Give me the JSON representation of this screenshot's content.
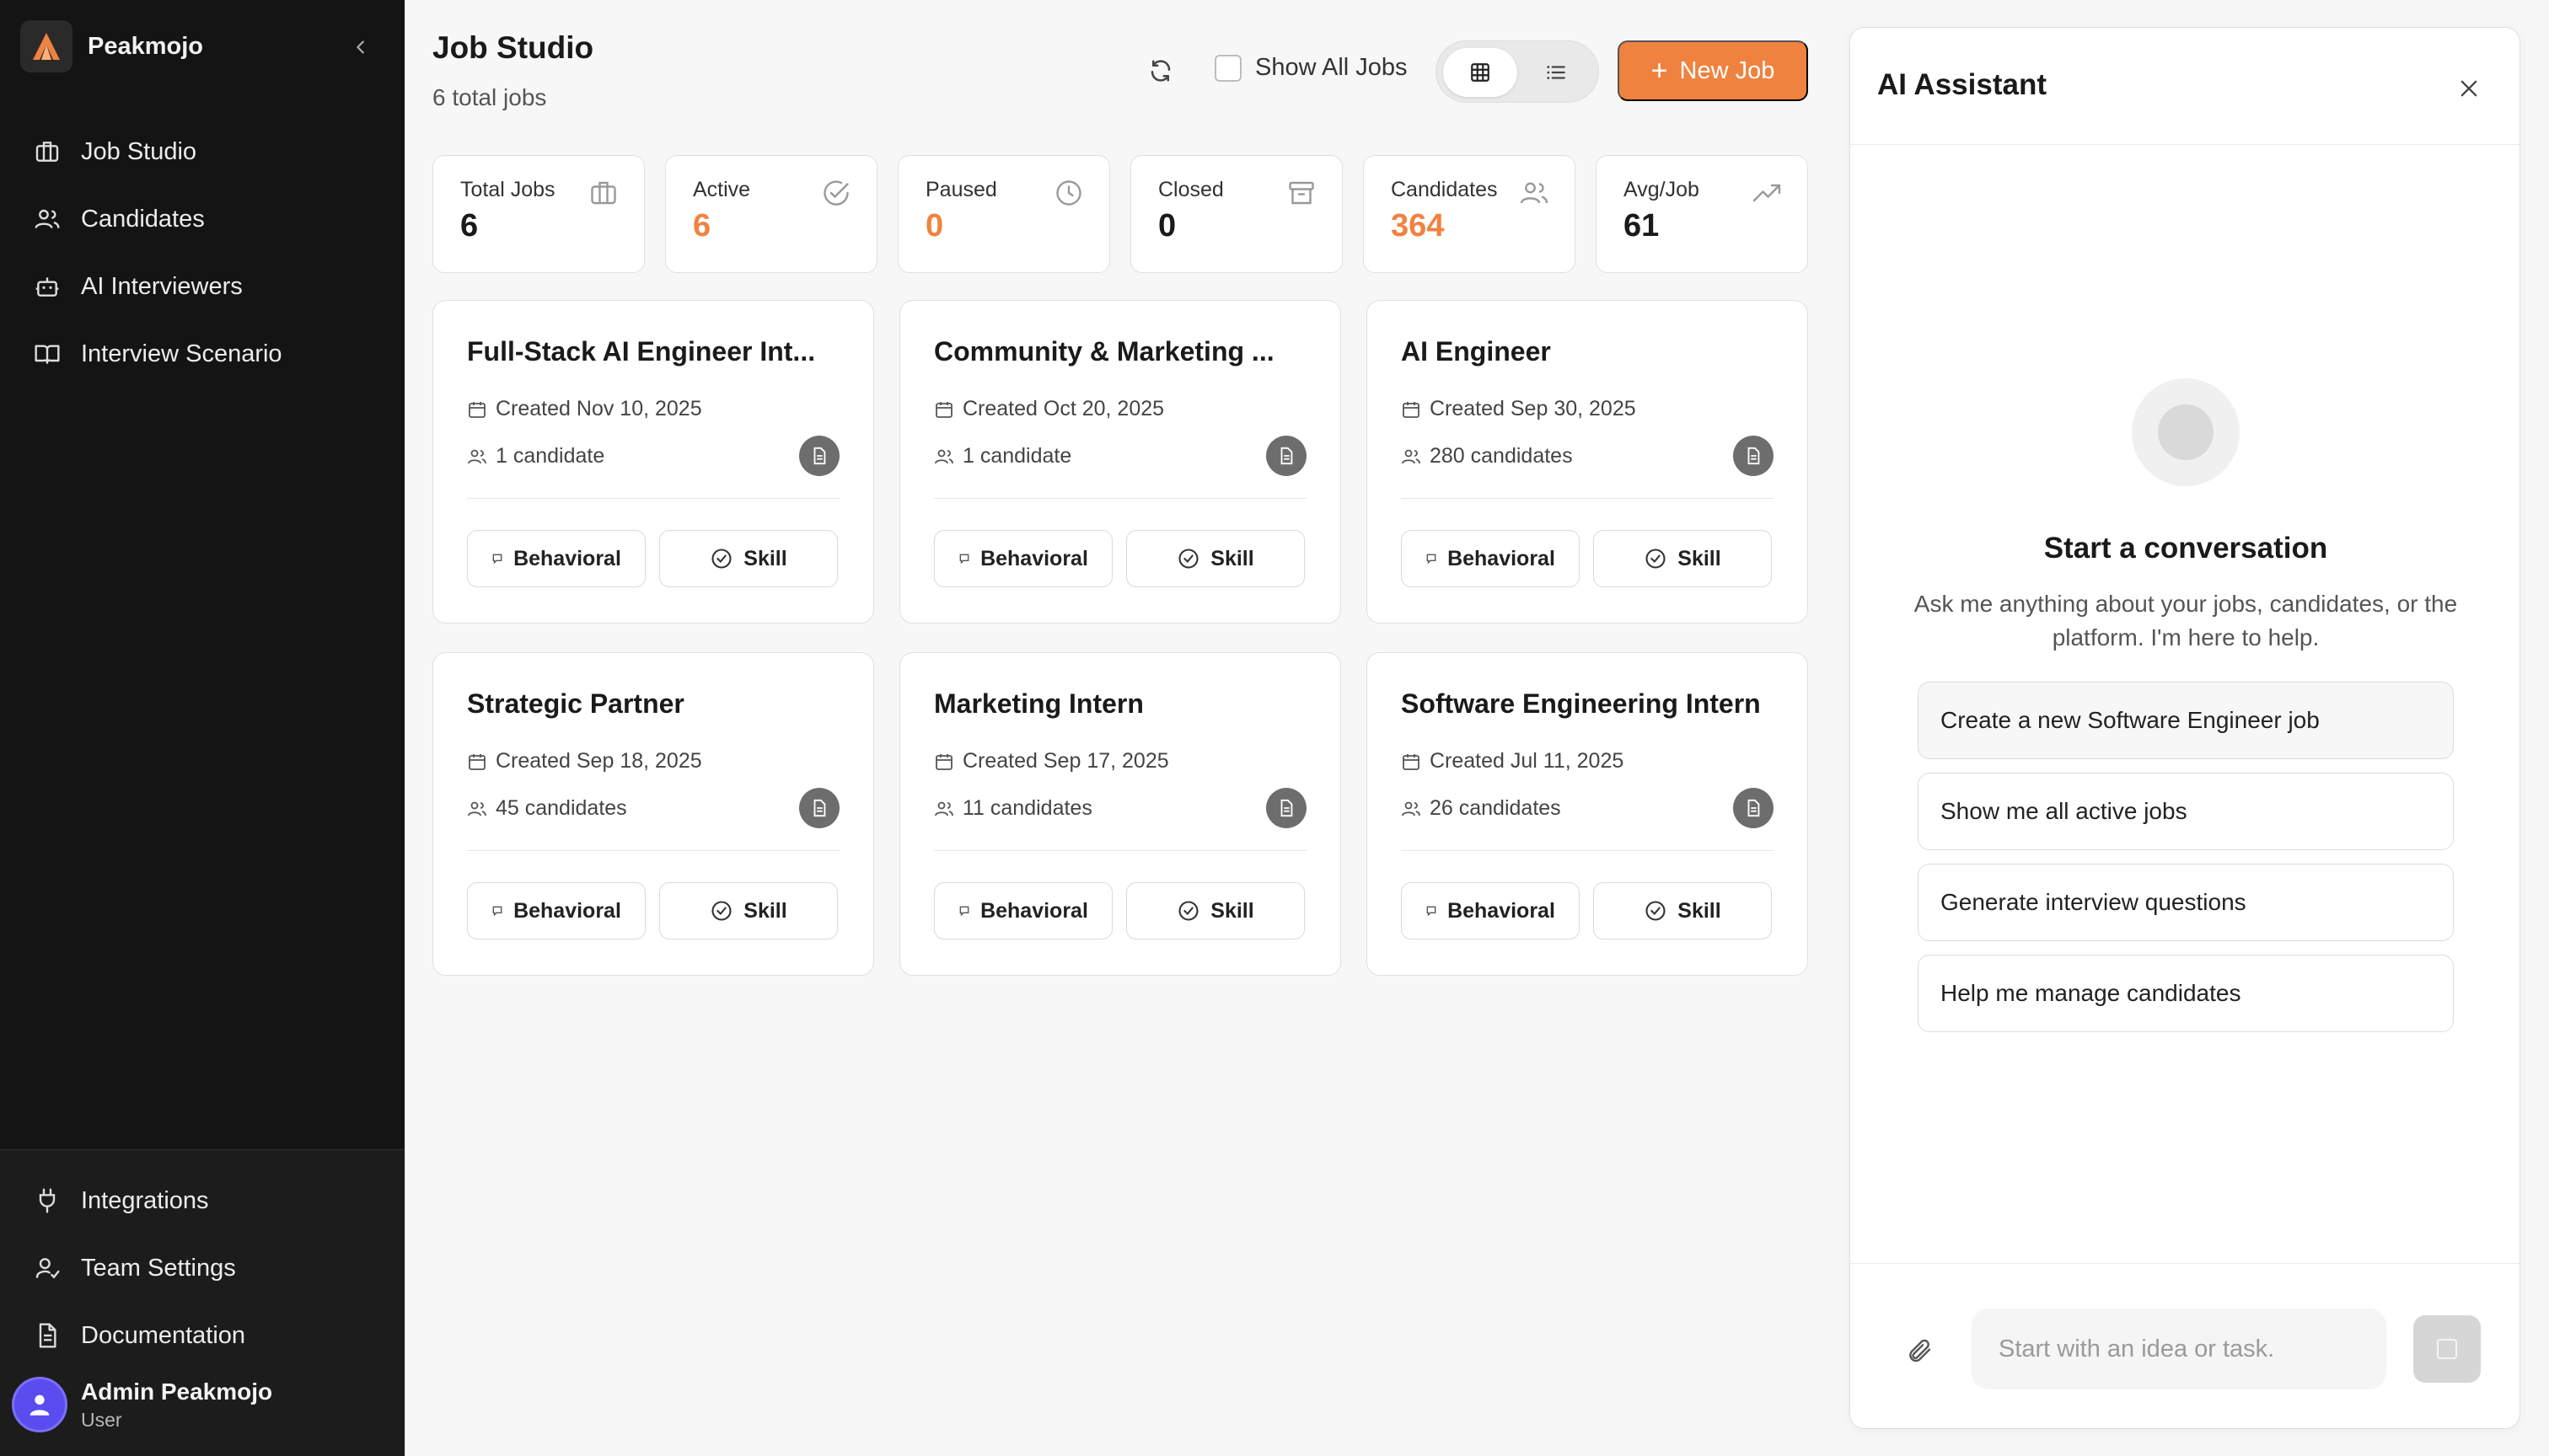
{
  "brand": {
    "name": "Peakmojo",
    "accent": "#f0823f"
  },
  "sidebar": {
    "items": [
      {
        "label": "Job Studio",
        "icon": "briefcase-icon"
      },
      {
        "label": "Candidates",
        "icon": "users-icon"
      },
      {
        "label": "AI Interviewers",
        "icon": "bot-icon"
      },
      {
        "label": "Interview Scenario",
        "icon": "book-icon"
      }
    ],
    "bottom_items": [
      {
        "label": "Integrations",
        "icon": "plug-icon"
      },
      {
        "label": "Team Settings",
        "icon": "user-settings-icon"
      },
      {
        "label": "Documentation",
        "icon": "document-icon"
      }
    ],
    "user": {
      "name": "Admin Peakmojo",
      "role": "User"
    }
  },
  "header": {
    "title": "Job Studio",
    "subtitle": "6 total jobs",
    "show_all_label": "Show All Jobs",
    "new_job_label": "New Job"
  },
  "stats": [
    {
      "label": "Total Jobs",
      "value": "6",
      "icon": "briefcase-icon"
    },
    {
      "label": "Active",
      "value": "6",
      "icon": "check-circle-icon"
    },
    {
      "label": "Paused",
      "value": "0",
      "icon": "clock-icon"
    },
    {
      "label": "Closed",
      "value": "0",
      "icon": "archive-icon"
    },
    {
      "label": "Candidates",
      "value": "364",
      "icon": "users-icon"
    },
    {
      "label": "Avg/Job",
      "value": "61",
      "icon": "trending-up-icon"
    }
  ],
  "jobs": [
    {
      "title": "Full-Stack AI Engineer Int...",
      "created": "Created Nov 10, 2025",
      "candidates": "1 candidate"
    },
    {
      "title": "Community & Marketing ...",
      "created": "Created Oct 20, 2025",
      "candidates": "1 candidate"
    },
    {
      "title": "AI Engineer",
      "created": "Created Sep 30, 2025",
      "candidates": "280 candidates"
    },
    {
      "title": "Strategic Partner",
      "created": "Created Sep 18, 2025",
      "candidates": "45 candidates"
    },
    {
      "title": "Marketing Intern",
      "created": "Created Sep 17, 2025",
      "candidates": "11 candidates"
    },
    {
      "title": "Software Engineering Intern",
      "created": "Created Jul 11, 2025",
      "candidates": "26 candidates"
    }
  ],
  "job_buttons": {
    "behavioral": "Behavioral",
    "skill": "Skill"
  },
  "assistant": {
    "title": "AI Assistant",
    "heading": "Start a conversation",
    "description": "Ask me anything about your jobs, candidates, or the platform. I'm here to help.",
    "suggestions": [
      "Create a new Software Engineer job",
      "Show me all active jobs",
      "Generate interview questions",
      "Help me manage candidates"
    ],
    "input_placeholder": "Start with an idea or task."
  }
}
